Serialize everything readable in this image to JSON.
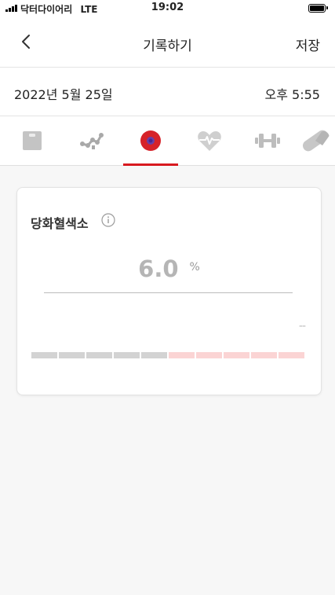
{
  "status_bar": {
    "carrier": "닥터다이어리",
    "network": "LTE",
    "time": "19:02"
  },
  "nav": {
    "title": "기록하기",
    "save_label": "저장",
    "back_icon": "chevron-left-icon"
  },
  "record": {
    "date": "2022년 5월 25일",
    "time": "오후 5:55"
  },
  "tabs": {
    "items": [
      {
        "icon": "scale-icon"
      },
      {
        "icon": "graph-nodes-icon"
      },
      {
        "icon": "blood-cell-icon",
        "selected": true
      },
      {
        "icon": "heart-pulse-icon"
      },
      {
        "icon": "dumbbell-icon"
      },
      {
        "icon": "pill-icon"
      }
    ],
    "active_color": "#d8191f"
  },
  "card": {
    "title": "당화혈색소",
    "value": "6.0",
    "unit": "%",
    "level_text": "--",
    "gauge": {
      "gray_segments": 5,
      "pink_segments": 5,
      "gray_color": "#d3d3d3",
      "pink_color": "#fbd4d4"
    }
  }
}
